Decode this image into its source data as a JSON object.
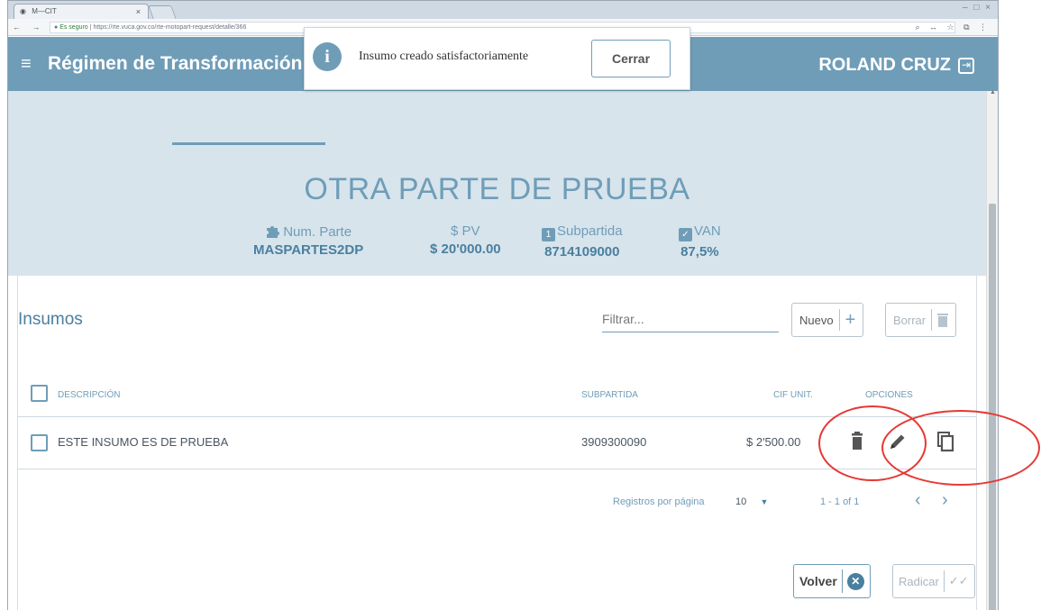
{
  "browser": {
    "tab_title": "M—CIT",
    "tab_close": "×",
    "window_controls": "– □ ×",
    "nav": "← → C",
    "url_secure": "Es seguro",
    "url_text": "https://rte.vuca.gov.co/rte-motopart-request/detalle/366",
    "addr_icons": "⌕ ↔ ☆ ⧉ ⋮"
  },
  "header": {
    "menu_icon": "≡",
    "title": "Régimen de Transformación",
    "user": "ROLAND CRUZ",
    "logout_icon": "⇥"
  },
  "toast": {
    "icon": "i",
    "message": "Insumo creado satisfactoriamente",
    "close_label": "Cerrar"
  },
  "part": {
    "name": "OTRA PARTE DE PRUEBA",
    "metrics": [
      {
        "icon": "puzzle-icon",
        "label": "Num. Parte",
        "value": "MASPARTES2DP"
      },
      {
        "icon": "dollar-icon",
        "label": "$ PV",
        "value": "$ 20'000.00"
      },
      {
        "icon": "subpartida-icon",
        "label": "Subpartida",
        "value": "8714109000"
      },
      {
        "icon": "checkbox-icon",
        "label": "VAN",
        "value": "87,5%"
      }
    ]
  },
  "insumos": {
    "title": "Insumos",
    "filter_placeholder": "Filtrar...",
    "new_label": "Nuevo",
    "new_icon": "+",
    "delete_label": "Borrar",
    "columns": {
      "description": "DESCRIPCIÓN",
      "subpartida": "SUBPARTIDA",
      "cif": "CIF UNIT.",
      "options": "OPCIONES"
    },
    "rows": [
      {
        "description": "ESTE INSUMO ES DE PRUEBA",
        "subpartida": "3909300090",
        "cif": "$ 2'500.00"
      }
    ],
    "pagination": {
      "rows_per_page_label": "Registros por página",
      "rows_per_page": "10",
      "caret": "▼",
      "range": "1 - 1 of 1",
      "prev": "‹",
      "next": "›"
    },
    "back_label": "Volver",
    "back_icon": "✕",
    "submit_label": "Radicar",
    "submit_icon": "✓✓"
  },
  "colors": {
    "primary": "#6f9db8",
    "primary_dark": "#4a7f9f",
    "header_band": "#d7e4ec",
    "annotation": "#e53935"
  }
}
